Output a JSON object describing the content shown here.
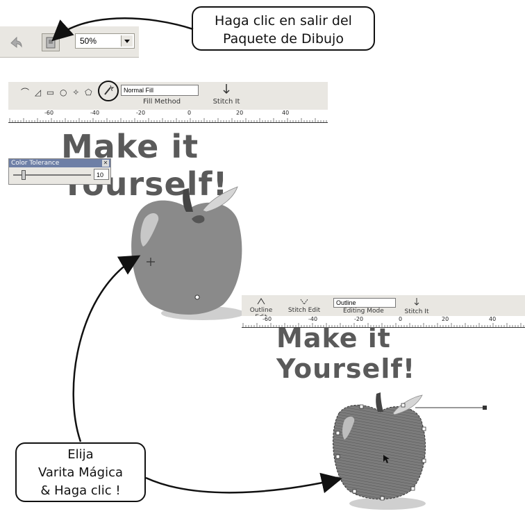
{
  "callouts": {
    "exit": {
      "line1": "Haga clic en salir del",
      "line2": "Paquete de Dibujo"
    },
    "wand": {
      "line1": "Elija",
      "line2": "Varita Mágica",
      "line3": "& Haga clic !"
    }
  },
  "mini_toolbar": {
    "zoom_value": "50%"
  },
  "screen1": {
    "fill_select": "Normal Fill",
    "fill_label": "Fill Method",
    "stitch_label": "Stitch It",
    "title": "Make it Yourself!",
    "ruler": [
      "-60",
      "-40",
      "-20",
      "0",
      "20",
      "40"
    ],
    "tolerance": {
      "title": "Color Tolerance",
      "value": "10"
    }
  },
  "screen2": {
    "outline_edit": "Outline Edit",
    "stitch_edit": "Stitch Edit",
    "mode_select": "Outline",
    "mode_label": "Editing Mode",
    "stitch_label": "Stitch It",
    "title": "Make it Yourself!",
    "ruler": [
      "-60",
      "-40",
      "-20",
      "0",
      "20",
      "40"
    ]
  },
  "icons": [
    "undo-icon",
    "exit-draw-icon",
    "dropdown-arrow-icon",
    "magic-wand-icon",
    "stitch-icon",
    "outline-edit-icon",
    "stitch-edit-icon",
    "close-icon"
  ],
  "colors": {
    "toolbar": "#e9e7e2",
    "apple": "#8a8a8a",
    "title": "#5a5a5a",
    "panel_title": "#6e7fa6"
  }
}
